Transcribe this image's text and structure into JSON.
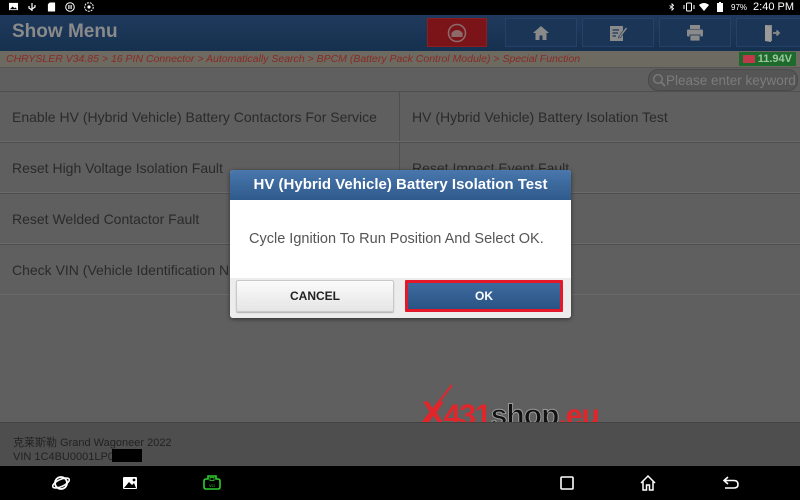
{
  "status_bar": {
    "left_icons": [
      "gallery-icon",
      "usb-icon",
      "sd-card-icon",
      "pause-icon",
      "sync-icon"
    ],
    "right_icons": [
      "bluetooth-icon",
      "vibrate-icon",
      "wifi-icon",
      "battery-icon"
    ],
    "battery_percent": "97%",
    "time": "2:40 PM"
  },
  "header": {
    "title": "Show Menu",
    "toolbar": [
      {
        "name": "diagnose-button",
        "icon": "car-globe-icon",
        "active": true
      },
      {
        "name": "home-button",
        "icon": "home-icon"
      },
      {
        "name": "report-button",
        "icon": "edit-note-icon"
      },
      {
        "name": "print-button",
        "icon": "printer-icon"
      },
      {
        "name": "exit-button",
        "icon": "exit-door-icon"
      }
    ]
  },
  "breadcrumb": {
    "text": "CHRYSLER V34.85 > 16 PIN Connector > Automatically Search > BPCM (Battery Pack Control Module) > Special Function"
  },
  "voltage": {
    "value": "11.94V",
    "color": "#1d6a2c"
  },
  "search": {
    "placeholder": "Please enter keyword",
    "value": ""
  },
  "menu": {
    "rows": [
      [
        "Enable HV (Hybrid Vehicle) Battery Contactors For Service",
        "HV (Hybrid Vehicle) Battery Isolation Test"
      ],
      [
        "Reset High Voltage Isolation Fault",
        "Reset Impact Event Fault"
      ],
      [
        "Reset Welded Contactor Fault",
        ""
      ],
      [
        "Check VIN (Vehicle Identification Number)",
        ""
      ]
    ]
  },
  "vehicle": {
    "name": "克莱斯勒 Grand Wagoneer 2022",
    "vin": "VIN 1C4BU0001LP0"
  },
  "watermark": {
    "x": "X",
    "num": "431",
    "shop": "shop",
    "tld": ".eu"
  },
  "dialog": {
    "title": "HV (Hybrid Vehicle) Battery Isolation Test",
    "message": "Cycle Ignition To Run Position And Select OK.",
    "cancel_label": "CANCEL",
    "ok_label": "OK",
    "highlight_color": "#e3182b",
    "header_color": "#3d6a9e"
  },
  "nav_bar": {
    "icons": [
      "browser-icon",
      "gallery-icon",
      "vci-icon",
      "recent-apps-icon",
      "home-icon",
      "back-icon"
    ],
    "vci_color": "#2ecc2e"
  }
}
